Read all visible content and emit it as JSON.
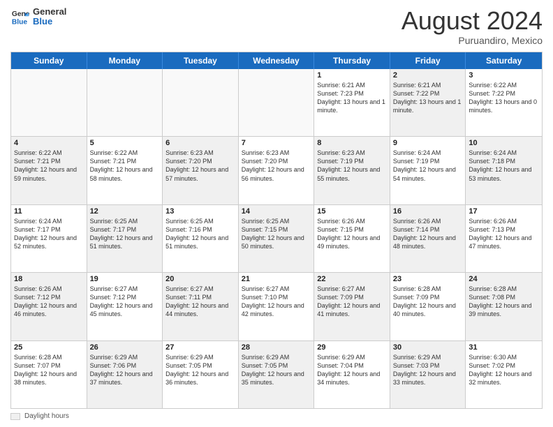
{
  "header": {
    "logo_line1": "General",
    "logo_line2": "Blue",
    "month_year": "August 2024",
    "location": "Puruandiro, Mexico"
  },
  "days_of_week": [
    "Sunday",
    "Monday",
    "Tuesday",
    "Wednesday",
    "Thursday",
    "Friday",
    "Saturday"
  ],
  "weeks": [
    [
      {
        "day": "",
        "info": "",
        "empty": true
      },
      {
        "day": "",
        "info": "",
        "empty": true
      },
      {
        "day": "",
        "info": "",
        "empty": true
      },
      {
        "day": "",
        "info": "",
        "empty": true
      },
      {
        "day": "1",
        "info": "Sunrise: 6:21 AM\nSunset: 7:23 PM\nDaylight: 13 hours\nand 1 minute.",
        "shaded": false
      },
      {
        "day": "2",
        "info": "Sunrise: 6:21 AM\nSunset: 7:22 PM\nDaylight: 13 hours\nand 1 minute.",
        "shaded": true
      },
      {
        "day": "3",
        "info": "Sunrise: 6:22 AM\nSunset: 7:22 PM\nDaylight: 13 hours\nand 0 minutes.",
        "shaded": false
      }
    ],
    [
      {
        "day": "4",
        "info": "Sunrise: 6:22 AM\nSunset: 7:21 PM\nDaylight: 12 hours\nand 59 minutes.",
        "shaded": true
      },
      {
        "day": "5",
        "info": "Sunrise: 6:22 AM\nSunset: 7:21 PM\nDaylight: 12 hours\nand 58 minutes.",
        "shaded": false
      },
      {
        "day": "6",
        "info": "Sunrise: 6:23 AM\nSunset: 7:20 PM\nDaylight: 12 hours\nand 57 minutes.",
        "shaded": true
      },
      {
        "day": "7",
        "info": "Sunrise: 6:23 AM\nSunset: 7:20 PM\nDaylight: 12 hours\nand 56 minutes.",
        "shaded": false
      },
      {
        "day": "8",
        "info": "Sunrise: 6:23 AM\nSunset: 7:19 PM\nDaylight: 12 hours\nand 55 minutes.",
        "shaded": true
      },
      {
        "day": "9",
        "info": "Sunrise: 6:24 AM\nSunset: 7:19 PM\nDaylight: 12 hours\nand 54 minutes.",
        "shaded": false
      },
      {
        "day": "10",
        "info": "Sunrise: 6:24 AM\nSunset: 7:18 PM\nDaylight: 12 hours\nand 53 minutes.",
        "shaded": true
      }
    ],
    [
      {
        "day": "11",
        "info": "Sunrise: 6:24 AM\nSunset: 7:17 PM\nDaylight: 12 hours\nand 52 minutes.",
        "shaded": false
      },
      {
        "day": "12",
        "info": "Sunrise: 6:25 AM\nSunset: 7:17 PM\nDaylight: 12 hours\nand 51 minutes.",
        "shaded": true
      },
      {
        "day": "13",
        "info": "Sunrise: 6:25 AM\nSunset: 7:16 PM\nDaylight: 12 hours\nand 51 minutes.",
        "shaded": false
      },
      {
        "day": "14",
        "info": "Sunrise: 6:25 AM\nSunset: 7:15 PM\nDaylight: 12 hours\nand 50 minutes.",
        "shaded": true
      },
      {
        "day": "15",
        "info": "Sunrise: 6:26 AM\nSunset: 7:15 PM\nDaylight: 12 hours\nand 49 minutes.",
        "shaded": false
      },
      {
        "day": "16",
        "info": "Sunrise: 6:26 AM\nSunset: 7:14 PM\nDaylight: 12 hours\nand 48 minutes.",
        "shaded": true
      },
      {
        "day": "17",
        "info": "Sunrise: 6:26 AM\nSunset: 7:13 PM\nDaylight: 12 hours\nand 47 minutes.",
        "shaded": false
      }
    ],
    [
      {
        "day": "18",
        "info": "Sunrise: 6:26 AM\nSunset: 7:12 PM\nDaylight: 12 hours\nand 46 minutes.",
        "shaded": true
      },
      {
        "day": "19",
        "info": "Sunrise: 6:27 AM\nSunset: 7:12 PM\nDaylight: 12 hours\nand 45 minutes.",
        "shaded": false
      },
      {
        "day": "20",
        "info": "Sunrise: 6:27 AM\nSunset: 7:11 PM\nDaylight: 12 hours\nand 44 minutes.",
        "shaded": true
      },
      {
        "day": "21",
        "info": "Sunrise: 6:27 AM\nSunset: 7:10 PM\nDaylight: 12 hours\nand 42 minutes.",
        "shaded": false
      },
      {
        "day": "22",
        "info": "Sunrise: 6:27 AM\nSunset: 7:09 PM\nDaylight: 12 hours\nand 41 minutes.",
        "shaded": true
      },
      {
        "day": "23",
        "info": "Sunrise: 6:28 AM\nSunset: 7:09 PM\nDaylight: 12 hours\nand 40 minutes.",
        "shaded": false
      },
      {
        "day": "24",
        "info": "Sunrise: 6:28 AM\nSunset: 7:08 PM\nDaylight: 12 hours\nand 39 minutes.",
        "shaded": true
      }
    ],
    [
      {
        "day": "25",
        "info": "Sunrise: 6:28 AM\nSunset: 7:07 PM\nDaylight: 12 hours\nand 38 minutes.",
        "shaded": false
      },
      {
        "day": "26",
        "info": "Sunrise: 6:29 AM\nSunset: 7:06 PM\nDaylight: 12 hours\nand 37 minutes.",
        "shaded": true
      },
      {
        "day": "27",
        "info": "Sunrise: 6:29 AM\nSunset: 7:05 PM\nDaylight: 12 hours\nand 36 minutes.",
        "shaded": false
      },
      {
        "day": "28",
        "info": "Sunrise: 6:29 AM\nSunset: 7:05 PM\nDaylight: 12 hours\nand 35 minutes.",
        "shaded": true
      },
      {
        "day": "29",
        "info": "Sunrise: 6:29 AM\nSunset: 7:04 PM\nDaylight: 12 hours\nand 34 minutes.",
        "shaded": false
      },
      {
        "day": "30",
        "info": "Sunrise: 6:29 AM\nSunset: 7:03 PM\nDaylight: 12 hours\nand 33 minutes.",
        "shaded": true
      },
      {
        "day": "31",
        "info": "Sunrise: 6:30 AM\nSunset: 7:02 PM\nDaylight: 12 hours\nand 32 minutes.",
        "shaded": false
      }
    ]
  ],
  "footer": {
    "legend_label": "Daylight hours"
  }
}
